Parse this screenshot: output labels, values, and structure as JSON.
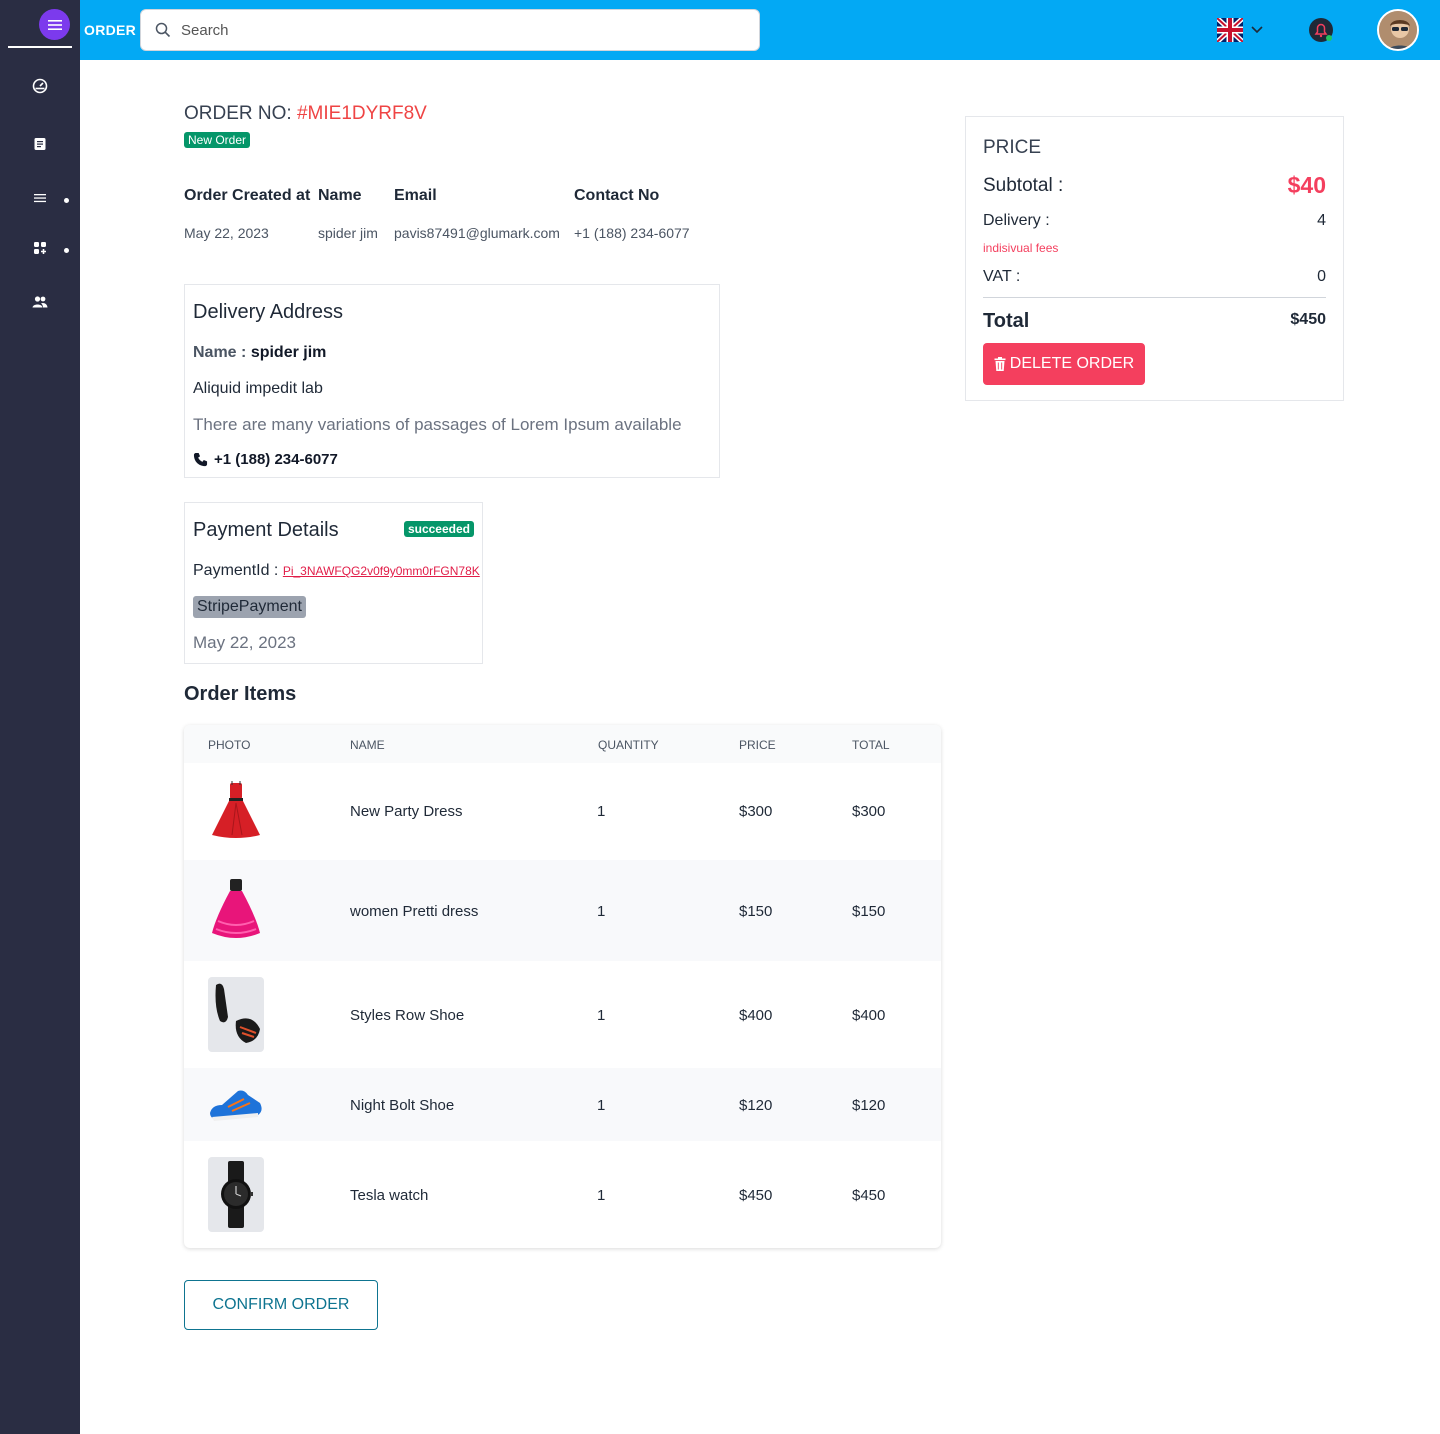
{
  "header": {
    "brand": "ORDER",
    "search_placeholder": "Search"
  },
  "order": {
    "label": "ORDER NO:",
    "number": "#MIE1DYRF8V",
    "status_badge": "New Order",
    "headers": [
      "Order Created at",
      "Name",
      "Email",
      "Contact No"
    ],
    "created_at": "May 22, 2023",
    "name": "spider jim",
    "email": "pavis87491@glumark.com",
    "contact": "+1 (188) 234-6077"
  },
  "delivery": {
    "title": "Delivery Address",
    "name_label": "Name :",
    "name": "spider jim",
    "line1": "Aliquid impedit lab",
    "line2": "There are many variations of passages of Lorem Ipsum available",
    "phone": "+1 (188) 234-6077"
  },
  "payment": {
    "title": "Payment Details",
    "status": "succeeded",
    "id_label": "PaymentId :",
    "id": "Pi_3NAWFQG2v0f9y0mm0rFGN78K",
    "method": "StripePayment",
    "date": "May 22, 2023"
  },
  "items": {
    "title": "Order Items",
    "columns": [
      "PHOTO",
      "NAME",
      "QUANTITY",
      "PRICE",
      "TOTAL"
    ],
    "rows": [
      {
        "name": "New Party Dress",
        "qty": "1",
        "price": "$300",
        "total": "$300",
        "photo": "red-dress"
      },
      {
        "name": "women Pretti dress",
        "qty": "1",
        "price": "$150",
        "total": "$150",
        "photo": "pink-dress"
      },
      {
        "name": "Styles Row Shoe",
        "qty": "1",
        "price": "$400",
        "total": "$400",
        "photo": "black-shoe"
      },
      {
        "name": "Night Bolt Shoe",
        "qty": "1",
        "price": "$120",
        "total": "$120",
        "photo": "blue-shoe"
      },
      {
        "name": "Tesla watch",
        "qty": "1",
        "price": "$450",
        "total": "$450",
        "photo": "watch"
      }
    ]
  },
  "actions": {
    "confirm": "CONFIRM ORDER",
    "delete": "DELETE ORDER"
  },
  "price": {
    "title": "PRICE",
    "subtotal_label": "Subtotal :",
    "subtotal": "$40",
    "delivery_label": "Delivery :",
    "delivery": "4",
    "fees_note": "indisivual fees",
    "vat_label": "VAT :",
    "vat": "0",
    "total_label": "Total",
    "total": "$450"
  },
  "colors": {
    "topbar": "#03a9f4",
    "sidebar": "#2a2d43",
    "accent_red": "#ef4444",
    "success": "#059669",
    "delete": "#f43f5e"
  }
}
